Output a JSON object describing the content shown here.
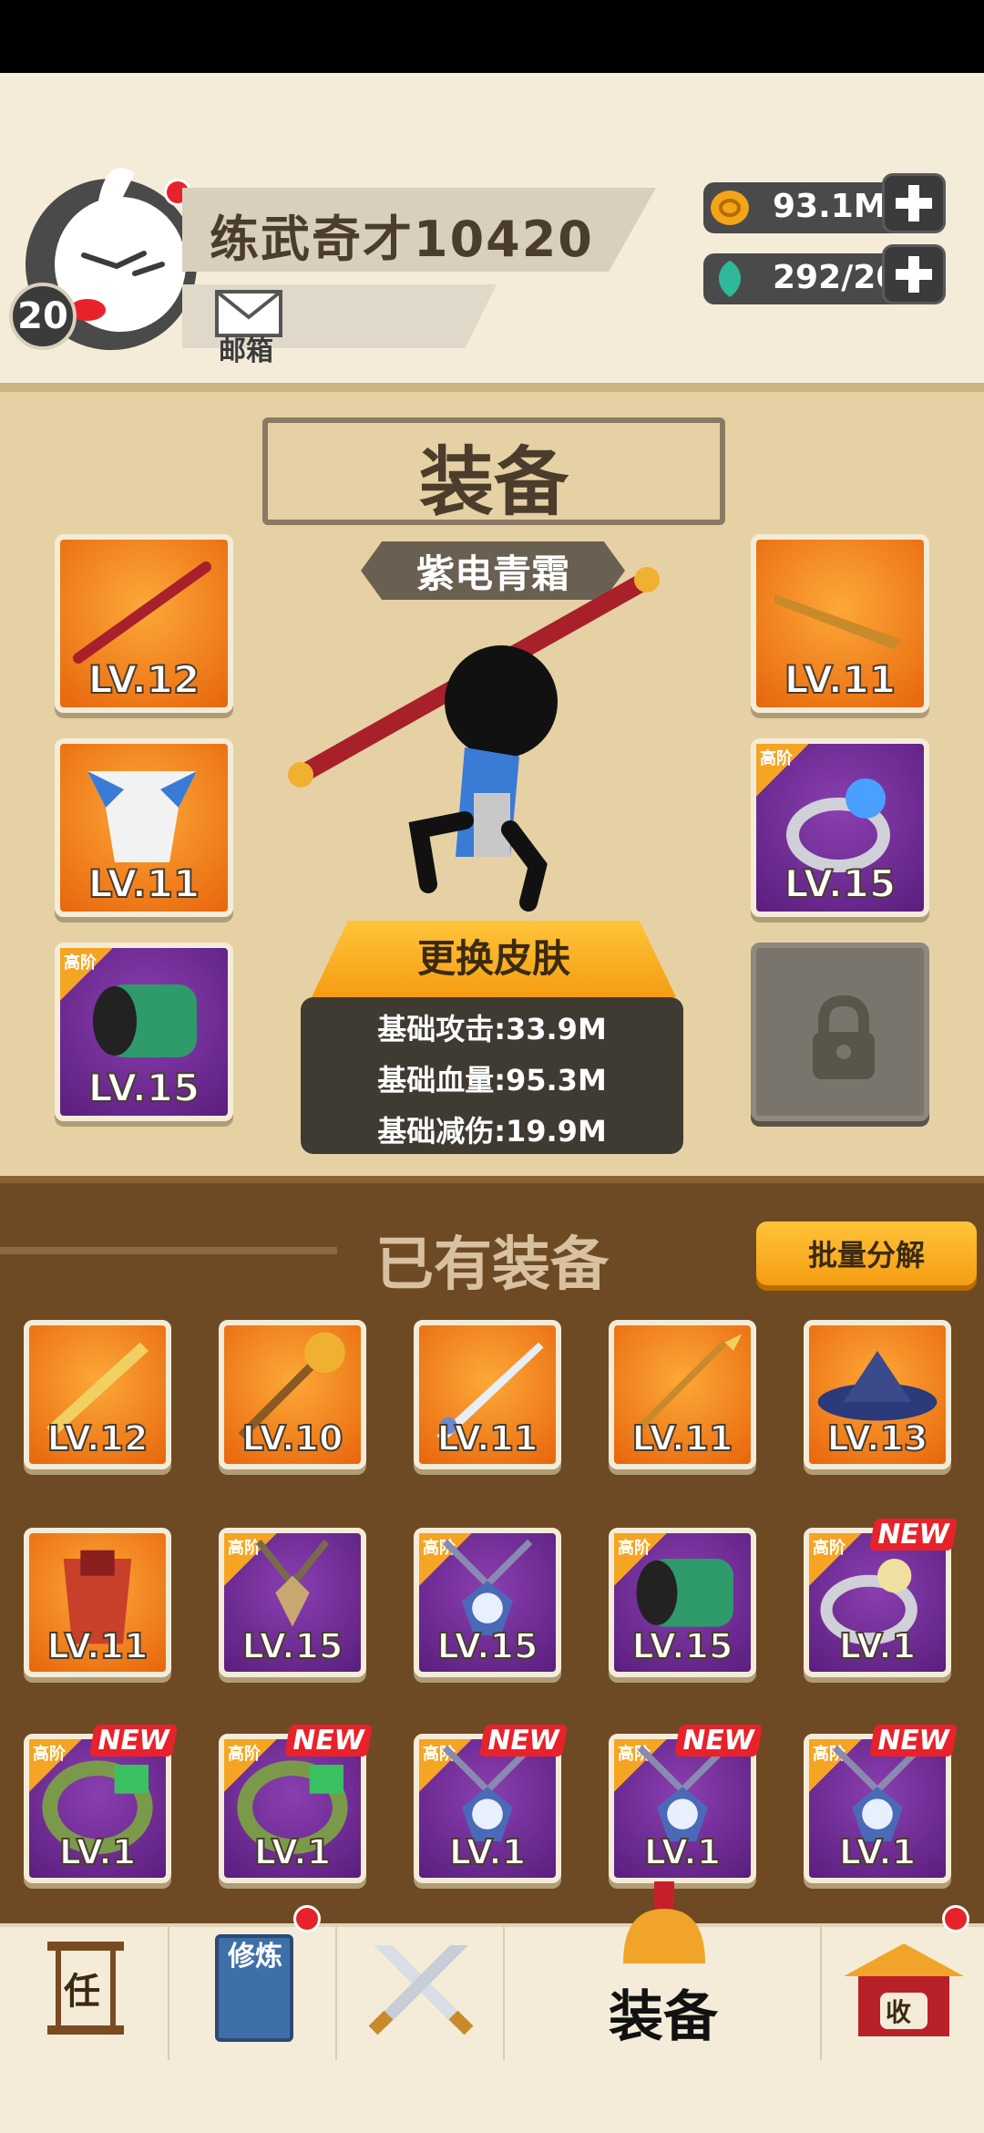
{
  "header": {
    "player_name": "练武奇才10420",
    "level": "20",
    "mail_label": "邮箱",
    "gold": "93.1M",
    "gems": "292/20"
  },
  "equipment": {
    "title": "装备",
    "skin_name": "紫电青霜",
    "change_skin_label": "更换皮肤",
    "left_slots": [
      {
        "type": "weapon-staff",
        "level": "LV.12",
        "rarity": "orange",
        "tier": ""
      },
      {
        "type": "armor",
        "level": "LV.11",
        "rarity": "orange",
        "tier": ""
      },
      {
        "type": "bracer",
        "level": "LV.15",
        "rarity": "purple",
        "tier": "高阶"
      }
    ],
    "right_slots": [
      {
        "type": "hairpin",
        "level": "LV.11",
        "rarity": "orange",
        "tier": ""
      },
      {
        "type": "ring",
        "level": "LV.15",
        "rarity": "purple",
        "tier": "高阶"
      },
      {
        "type": "locked",
        "level": "",
        "rarity": "locked",
        "tier": ""
      }
    ],
    "stats": {
      "attack": "基础攻击:33.9M",
      "hp": "基础血量:95.3M",
      "reduction": "基础减伤:19.9M"
    }
  },
  "inventory": {
    "title": "已有装备",
    "bulk_button": "批量分解",
    "items": [
      {
        "icon": "sword-icon",
        "level": "LV.12",
        "rarity": "orange",
        "tier": "",
        "new": ""
      },
      {
        "icon": "mace-icon",
        "level": "LV.10",
        "rarity": "orange",
        "tier": "",
        "new": ""
      },
      {
        "icon": "blade-icon",
        "level": "LV.11",
        "rarity": "orange",
        "tier": "",
        "new": ""
      },
      {
        "icon": "spear-icon",
        "level": "LV.11",
        "rarity": "orange",
        "tier": "",
        "new": ""
      },
      {
        "icon": "hat-icon",
        "level": "LV.13",
        "rarity": "orange",
        "tier": "",
        "new": ""
      },
      {
        "icon": "armor-icon",
        "level": "LV.11",
        "rarity": "orange",
        "tier": "",
        "new": ""
      },
      {
        "icon": "amulet-icon",
        "level": "LV.15",
        "rarity": "purple",
        "tier": "高阶",
        "new": ""
      },
      {
        "icon": "necklace-icon",
        "level": "LV.15",
        "rarity": "purple",
        "tier": "高阶",
        "new": ""
      },
      {
        "icon": "bracer-icon",
        "level": "LV.15",
        "rarity": "purple",
        "tier": "高阶",
        "new": ""
      },
      {
        "icon": "ring-icon",
        "level": "LV.1",
        "rarity": "purple",
        "tier": "高阶",
        "new": "NEW"
      },
      {
        "icon": "jade-bracelet-icon",
        "level": "LV.1",
        "rarity": "purple",
        "tier": "高阶",
        "new": "NEW"
      },
      {
        "icon": "jade-bracelet-icon",
        "level": "LV.1",
        "rarity": "purple",
        "tier": "高阶",
        "new": "NEW"
      },
      {
        "icon": "necklace-icon",
        "level": "LV.1",
        "rarity": "purple",
        "tier": "高阶",
        "new": "NEW"
      },
      {
        "icon": "necklace-icon",
        "level": "LV.1",
        "rarity": "purple",
        "tier": "高阶",
        "new": "NEW"
      },
      {
        "icon": "necklace-icon",
        "level": "LV.1",
        "rarity": "purple",
        "tier": "高阶",
        "new": "NEW"
      }
    ]
  },
  "nav": {
    "task_glyph": "任",
    "train_glyph": "修炼",
    "equip_label": "装备",
    "shop_glyph": "收"
  },
  "colors": {
    "orange_rarity": "#f08a1c",
    "purple_rarity": "#6a2a90",
    "accent_red": "#e8222a",
    "button_gold": "#f5a523"
  }
}
